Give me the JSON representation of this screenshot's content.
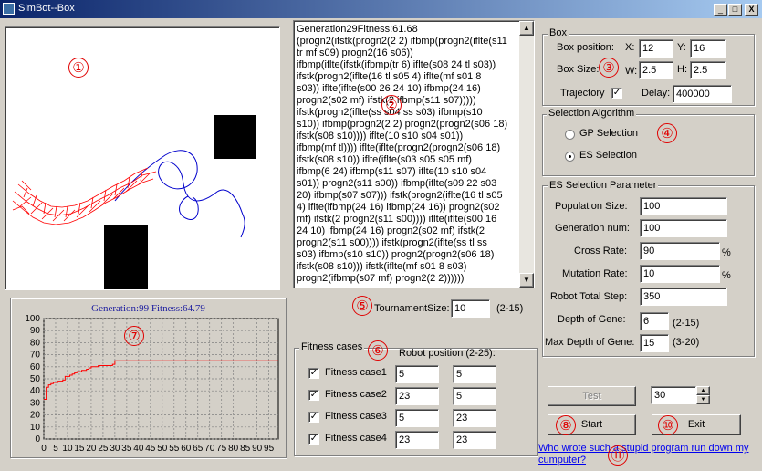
{
  "window": {
    "title": "SimBot--Box",
    "min_glyph": "_",
    "max_glyph": "□",
    "close_glyph": "X"
  },
  "markers": [
    "①",
    "②",
    "③",
    "④",
    "⑤",
    "⑥",
    "⑦",
    "⑧",
    "⑨",
    "⑩",
    "⑪"
  ],
  "gp_text": "Generation29Fitness:61.68\n(progn2(ifstk(progn2(2 2) ifbmp(progn2(iflte(s11\ntr mf s09) progn2(16 s06))\nifbmp(iflte(ifstk(ifbmp(tr 6) iflte(s08 24 tl s03))\nifstk(progn2(iflte(16 tl s05 4) iflte(mf s01 8\ns03)) iflte(iflte(s00 26 24 10) ifbmp(24 16)\nprogn2(s02 mf) ifstk(2 ifbmp(s11 s07)))))\nifstk(progn2(iflte(ss s04 ss s03) ifbmp(s10\ns10)) ifbmp(progn2(2 2) progn2(progn2(s06 18)\nifstk(s08 s10)))) iflte(10 s10 s04 s01))\nifbmp(mf tl)))) iflte(iflte(progn2(progn2(s06 18)\nifstk(s08 s10)) iflte(iflte(s03 s05 s05 mf)\nifbmp(6 24) ifbmp(s11 s07) iflte(10 s10 s04\ns01)) progn2(s11 s00)) ifbmp(iflte(s09 22 s03\n20) ifbmp(s07 s07))) ifstk(progn2(iflte(16 tl s05\n4) iflte(ifbmp(24 16) ifbmp(24 16)) progn2(s02\nmf) ifstk(2 progn2(s11 s00)))) iflte(iflte(s00 16\n24 10) ifbmp(24 16) progn2(s02 mf) ifstk(2\nprogn2(s11 s00)))) ifstk(progn2(iflte(ss tl ss\ns03) ifbmp(s10 s10)) progn2(progn2(s06 18)\nifstk(s08 s10))) ifstk(iflte(mf s01 8 s03)\nprogn2(ifbmp(s07 mf) progn2(2 2))))))\n------------------------------",
  "box": {
    "group_label": "Box",
    "position_label": "Box position:",
    "x_label": "X:",
    "x_value": "12",
    "y_label": "Y:",
    "y_value": "16",
    "size_label": "Box Size:",
    "w_label": "W:",
    "w_value": "2.5",
    "h_label": "H:",
    "h_value": "2.5",
    "trajectory_label": "Trajectory",
    "trajectory_checked": "✓",
    "delay_label": "Delay:",
    "delay_value": "400000"
  },
  "selection": {
    "group_label": "Selection Algorithm",
    "gp_label": "GP Selection",
    "es_label": "ES Selection"
  },
  "es": {
    "group_label": "ES Selection Parameter",
    "population_label": "Population Size:",
    "population_value": "100",
    "generation_label": "Generation num:",
    "generation_value": "100",
    "cross_label": "Cross Rate:",
    "cross_value": "90",
    "cross_unit": "%",
    "mutation_label": "Mutation Rate:",
    "mutation_value": "10",
    "mutation_unit": "%",
    "robot_step_label": "Robot Total Step:",
    "robot_step_value": "350",
    "depth_label": "Depth of Gene:",
    "depth_value": "6",
    "depth_range": "(2-15)",
    "max_depth_label": "Max Depth of Gene:",
    "max_depth_value": "15",
    "max_depth_range": "(3-20)"
  },
  "tournament": {
    "label": "TournamentSize:",
    "value": "10",
    "range": "(2-15)"
  },
  "fitness": {
    "group_label": "Fitness cases",
    "robot_position_label": "Robot position (2-25):",
    "cases": [
      {
        "label": "Fitness case1",
        "checked": "✓",
        "x": "5",
        "y": "5"
      },
      {
        "label": "Fitness case2",
        "checked": "✓",
        "x": "23",
        "y": "5"
      },
      {
        "label": "Fitness case3",
        "checked": "✓",
        "x": "5",
        "y": "23"
      },
      {
        "label": "Fitness case4",
        "checked": "✓",
        "x": "23",
        "y": "23"
      }
    ]
  },
  "chart_data": {
    "type": "line",
    "title": "Generation:99 Fitness:64.79",
    "xlabel": "",
    "ylabel": "",
    "xlim": [
      0,
      99
    ],
    "ylim": [
      0,
      100
    ],
    "y_ticks": [
      0,
      10,
      20,
      30,
      40,
      50,
      60,
      70,
      80,
      90,
      100
    ],
    "x_ticks": [
      0,
      5,
      10,
      15,
      20,
      25,
      30,
      35,
      40,
      45,
      50,
      55,
      60,
      65,
      70,
      75,
      80,
      85,
      90,
      95
    ],
    "grid": true,
    "series": [
      {
        "color": "#ff0000",
        "x": [
          0,
          1,
          2,
          3,
          4,
          5,
          6,
          7,
          8,
          9,
          10,
          11,
          12,
          13,
          14,
          15,
          16,
          17,
          18,
          19,
          20,
          21,
          22,
          23,
          24,
          25,
          26,
          27,
          28,
          29,
          30,
          99
        ],
        "y": [
          33,
          43,
          45,
          46,
          47,
          47,
          48,
          48,
          49,
          52,
          52,
          53,
          54,
          55,
          56,
          56,
          57,
          57,
          58,
          59,
          60,
          60,
          60,
          61,
          61,
          61,
          61,
          61,
          61,
          62,
          65,
          65
        ]
      }
    ]
  },
  "controls": {
    "test_label": "Test",
    "spin_value": "30",
    "start_label": "Start",
    "exit_label": "Exit",
    "link_line1": "Who wrote such a stupid program run down my",
    "link_line2": "cumputer?"
  },
  "colors": {
    "trajectory_red": "#ff0000",
    "trajectory_blue": "#0000cc",
    "obstacle": "#000000",
    "fitness_title": "#2020a0"
  }
}
